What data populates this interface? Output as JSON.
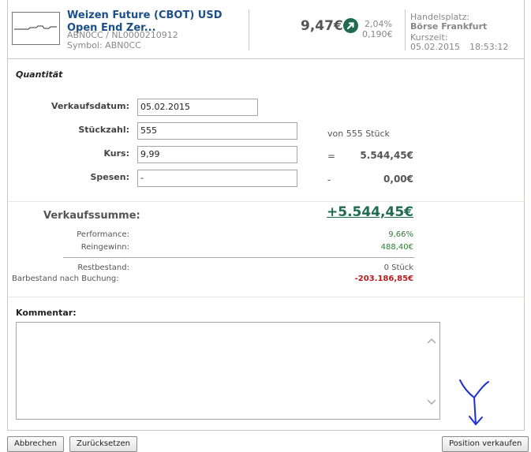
{
  "header": {
    "title_line1": "Weizen Future (CBOT) USD",
    "title_line2": "Open End Zer...",
    "isin": "ABN0CC / NL0000210912",
    "symbol": "Symbol: ABN0CC",
    "price": "9,47€",
    "change_pct": "2,04%",
    "change_abs": "0,190€",
    "exchange_label": "Handelsplatz:",
    "exchange_value": "Börse Frankfurt",
    "time_label": "Kurszeit:",
    "time_date": "05.02.2015",
    "time_clock": "18:53:12"
  },
  "form": {
    "section_title": "Quantität",
    "verkaufsdatum_label": "Verkaufsdatum:",
    "verkaufsdatum_value": "05.02.2015",
    "stueckzahl_label": "Stückzahl:",
    "stueckzahl_value": "555",
    "stueckzahl_note": "von 555 Stück",
    "kurs_label": "Kurs:",
    "kurs_value": "9,99",
    "kurs_op": "=",
    "kurs_total": "5.544,45€",
    "spesen_label": "Spesen:",
    "spesen_value": "-",
    "spesen_op": "-",
    "spesen_total": "0,00€"
  },
  "summary": {
    "verkaufssumme_label": "Verkaufssumme:",
    "verkaufssumme_value": "+5.544,45€",
    "performance_label": "Performance:",
    "performance_value": "9,66%",
    "reingewinn_label": "Reingewinn:",
    "reingewinn_value": "488,40€",
    "restbestand_label": "Restbestand:",
    "restbestand_value": "0 Stück",
    "barbestand_label": "Barbestand nach Buchung:",
    "barbestand_value": "-203.186,85€"
  },
  "comment": {
    "label": "Kommentar:",
    "value": ""
  },
  "buttons": {
    "abbrechen": "Abbrechen",
    "zuruecksetzen": "Zurücksetzen",
    "position_verkaufen": "Position verkaufen"
  },
  "colors": {
    "title_blue": "#1b4f8a",
    "positive_green": "#2e7d32",
    "negative_red": "#b71c1c",
    "arrow_icon_green": "#1f6b52",
    "annotation_blue": "#1a2fd6"
  },
  "icons": {
    "price_trend": "arrow-up-right-icon",
    "scroll_up": "chevron-up-icon",
    "scroll_down": "chevron-down-icon"
  }
}
